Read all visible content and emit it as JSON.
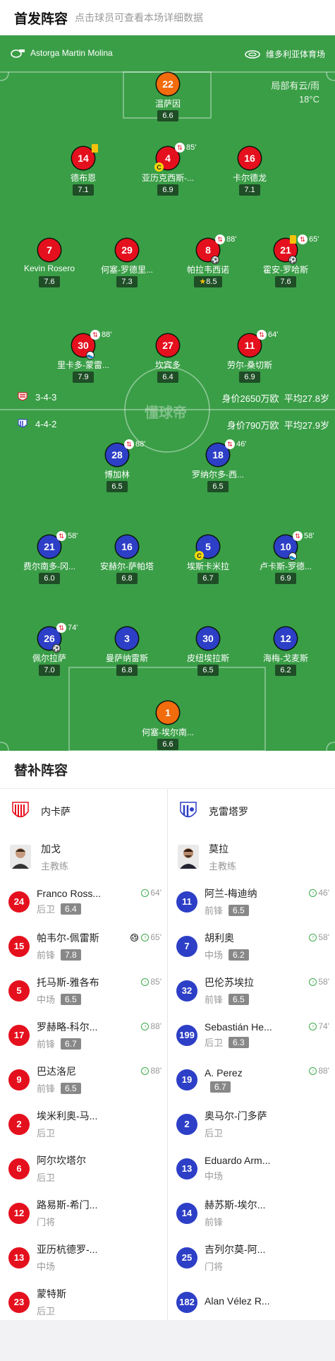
{
  "header": {
    "title": "首发阵容",
    "hint": "点击球员可查看本场详细数据"
  },
  "pitch": {
    "referee": "Astorga Martin Molina",
    "stadium": "维多利亚体育场",
    "weather": "局部有云/雨",
    "temperature": "18°C",
    "watermark": "懂球帝",
    "home_formation": "3-4-3",
    "home_value": "身价2650万欧",
    "home_age": "平均27.8岁",
    "away_formation": "4-4-2",
    "away_value": "身价790万欧",
    "away_age": "平均27.9岁",
    "home_players": [
      {
        "number": "22",
        "name": "温萨因",
        "rating": "6.6"
      },
      {
        "number": "14",
        "name": "德布恩",
        "rating": "7.1"
      },
      {
        "number": "4",
        "name": "亚历克西斯-...",
        "rating": "6.9",
        "sub_min": "85'"
      },
      {
        "number": "16",
        "name": "卡尔德龙",
        "rating": "7.1"
      },
      {
        "number": "7",
        "name": "Kevin Rosero",
        "rating": "7.6"
      },
      {
        "number": "29",
        "name": "何塞-罗德里...",
        "rating": "7.3"
      },
      {
        "number": "8",
        "name": "帕拉韦西诺",
        "rating": "8.5",
        "sub_min": "88'"
      },
      {
        "number": "21",
        "name": "霍安-罗哈斯",
        "rating": "7.6",
        "sub_min": "65'"
      },
      {
        "number": "30",
        "name": "里卡多-蒙雷...",
        "rating": "7.9",
        "sub_min": "88'"
      },
      {
        "number": "27",
        "name": "坎宾多",
        "rating": "6.4"
      },
      {
        "number": "11",
        "name": "劳尔-桑切斯",
        "rating": "6.9",
        "sub_min": "64'"
      }
    ],
    "away_players": [
      {
        "number": "28",
        "name": "博加林",
        "rating": "6.5",
        "sub_min": "88'"
      },
      {
        "number": "18",
        "name": "罗纳尔多-西...",
        "rating": "6.5",
        "sub_min": "46'"
      },
      {
        "number": "21",
        "name": "费尔南多-冈...",
        "rating": "6.0",
        "sub_min": "58'"
      },
      {
        "number": "16",
        "name": "安赫尔-萨帕塔",
        "rating": "6.8"
      },
      {
        "number": "5",
        "name": "埃斯卡米拉",
        "rating": "6.7"
      },
      {
        "number": "10",
        "name": "卢卡斯-罗德...",
        "rating": "6.9",
        "sub_min": "58'"
      },
      {
        "number": "26",
        "name": "佩尔拉萨",
        "rating": "7.0",
        "sub_min": "74'"
      },
      {
        "number": "3",
        "name": "曼萨纳雷斯",
        "rating": "6.8"
      },
      {
        "number": "30",
        "name": "皮纽埃拉斯",
        "rating": "6.5"
      },
      {
        "number": "12",
        "name": "海梅-戈麦斯",
        "rating": "6.2"
      },
      {
        "number": "1",
        "name": "何塞-埃尔南...",
        "rating": "6.6"
      }
    ]
  },
  "subs": {
    "title": "替补阵容",
    "home_team": "内卡萨",
    "away_team": "克雷塔罗",
    "home_coach": "加戈",
    "away_coach": "莫拉",
    "coach_label": "主教练",
    "home": [
      {
        "number": "24",
        "name": "Franco Ross...",
        "pos": "后卫",
        "rating": "6.4",
        "min": "64'"
      },
      {
        "number": "15",
        "name": "帕韦尔-佩雷斯",
        "pos": "前锋",
        "rating": "7.8",
        "min": "65'"
      },
      {
        "number": "5",
        "name": "托马斯-雅各布",
        "pos": "中场",
        "rating": "6.5",
        "min": "85'"
      },
      {
        "number": "17",
        "name": "罗赫略-科尔...",
        "pos": "前锋",
        "rating": "6.7",
        "min": "88'"
      },
      {
        "number": "9",
        "name": "巴达洛尼",
        "pos": "前锋",
        "rating": "6.5",
        "min": "88'"
      },
      {
        "number": "2",
        "name": "埃米利奥-马...",
        "pos": "后卫"
      },
      {
        "number": "6",
        "name": "阿尔坎塔尔",
        "pos": "后卫"
      },
      {
        "number": "12",
        "name": "路易斯-希门...",
        "pos": "门将"
      },
      {
        "number": "13",
        "name": "亚历杭德罗-...",
        "pos": "中场"
      },
      {
        "number": "23",
        "name": "蒙特斯",
        "pos": "后卫"
      }
    ],
    "away": [
      {
        "number": "11",
        "name": "阿兰-梅迪纳",
        "pos": "前锋",
        "rating": "6.5",
        "min": "46'"
      },
      {
        "number": "7",
        "name": "胡利奥",
        "pos": "中场",
        "rating": "6.2",
        "min": "58'"
      },
      {
        "number": "32",
        "name": "巴伦苏埃拉",
        "pos": "前锋",
        "rating": "6.5",
        "min": "58'"
      },
      {
        "number": "199",
        "name": "Sebastián He...",
        "pos": "后卫",
        "rating": "6.3",
        "min": "74'"
      },
      {
        "number": "19",
        "name": "A. Perez",
        "pos": "",
        "rating": "6.7",
        "min": "88'"
      },
      {
        "number": "2",
        "name": "奥马尔-门多萨",
        "pos": "后卫"
      },
      {
        "number": "13",
        "name": "Eduardo Arm...",
        "pos": "中场"
      },
      {
        "number": "14",
        "name": "赫苏斯-埃尔...",
        "pos": "前锋"
      },
      {
        "number": "25",
        "name": "吉列尔莫-阿...",
        "pos": "门将"
      },
      {
        "number": "182",
        "name": "Alan Vélez R...",
        "pos": ""
      }
    ]
  },
  "colors": {
    "pitch": "#3a9e47",
    "home": "#e5101d",
    "away": "#2d3fc6",
    "keeper": "#f26b0c"
  },
  "icons": [
    "whistle-icon",
    "stadium-icon",
    "sub-icon",
    "captain-icon",
    "yellow-card-icon",
    "goal-icon",
    "star-icon",
    "sub-up-icon"
  ]
}
